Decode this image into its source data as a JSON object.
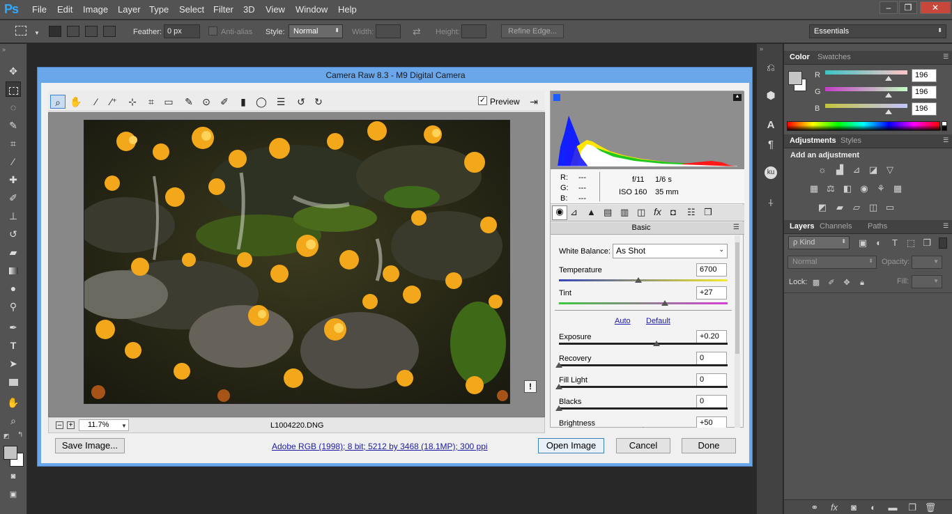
{
  "app": {
    "logo": "Ps",
    "menu": [
      "File",
      "Edit",
      "Image",
      "Layer",
      "Type",
      "Select",
      "Filter",
      "3D",
      "View",
      "Window",
      "Help"
    ],
    "window_buttons": [
      "–",
      "❐",
      "✕"
    ],
    "workspace": "Essentials"
  },
  "options": {
    "feather_label": "Feather:",
    "feather_value": "0 px",
    "antialias_label": "Anti-alias",
    "style_label": "Style:",
    "style_value": "Normal",
    "width_label": "Width:",
    "height_label": "Height:",
    "refine_edge": "Refine Edge..."
  },
  "toolbar": {
    "tools": [
      "move-tool",
      "rectangular-marquee-tool",
      "lasso-tool",
      "quick-selection-tool",
      "crop-tool",
      "eyedropper-tool",
      "spot-healing-brush-tool",
      "brush-tool",
      "clone-stamp-tool",
      "history-brush-tool",
      "eraser-tool",
      "gradient-tool",
      "blur-tool",
      "dodge-tool",
      "pen-tool",
      "type-tool",
      "path-selection-tool",
      "rectangle-tool",
      "hand-tool",
      "zoom-tool"
    ],
    "type_glyph": "T"
  },
  "color_panel": {
    "tabs": [
      "Color",
      "Swatches"
    ],
    "channels": [
      {
        "label": "R",
        "value": "196"
      },
      {
        "label": "G",
        "value": "196"
      },
      {
        "label": "B",
        "value": "196"
      }
    ],
    "swatch_color": "#c4c4c4"
  },
  "adjustments_panel": {
    "tabs": [
      "Adjustments",
      "Styles"
    ],
    "heading": "Add an adjustment"
  },
  "layers_panel": {
    "tabs": [
      "Layers",
      "Channels",
      "Paths"
    ],
    "kind_label": "ρ Kind",
    "blend_mode": "Normal",
    "opacity_label": "Opacity:",
    "lock_label": "Lock:",
    "fill_label": "Fill:"
  },
  "right_strip": {
    "text_glyph": "A",
    "paragraph_glyph": "¶",
    "kuler_label": "ku"
  },
  "camera_raw": {
    "title": "Camera Raw 8.3  -  M9 Digital Camera",
    "preview_label": "Preview",
    "zoom_value": "11.7%",
    "filename": "L1004220.DNG",
    "zoom_minus": "–",
    "zoom_plus": "+",
    "rgb_labels": [
      "R:",
      "G:",
      "B:"
    ],
    "rgb_values": [
      "---",
      "---",
      "---"
    ],
    "exif": {
      "aperture": "f/11",
      "shutter": "1/6 s",
      "iso": "ISO 160",
      "focal": "35 mm"
    },
    "panel_title": "Basic",
    "white_balance_label": "White Balance:",
    "white_balance_value": "As Shot",
    "temperature_label": "Temperature",
    "temperature_value": "6700",
    "tint_label": "Tint",
    "tint_value": "+27",
    "auto_link": "Auto",
    "default_link": "Default",
    "sliders": [
      {
        "label": "Exposure",
        "value": "+0.20",
        "position": 0.58
      },
      {
        "label": "Recovery",
        "value": "0",
        "position": 0.0
      },
      {
        "label": "Fill Light",
        "value": "0",
        "position": 0.0
      },
      {
        "label": "Blacks",
        "value": "0",
        "position": 0.0
      },
      {
        "label": "Brightness",
        "value": "+50",
        "position": 0.5
      }
    ],
    "temperature_position": 0.47,
    "tint_position": 0.63,
    "save_button": "Save Image...",
    "workflow_link": "Adobe RGB (1998); 8 bit; 5212 by 3468 (18.1MP); 300 ppi",
    "open_button": "Open Image",
    "cancel_button": "Cancel",
    "done_button": "Done",
    "warning_glyph": "!"
  }
}
